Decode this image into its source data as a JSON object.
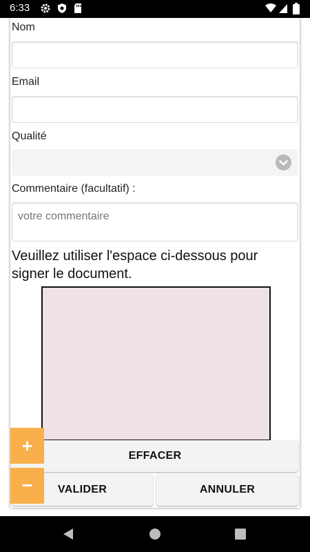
{
  "status_bar": {
    "time": "6:33"
  },
  "form": {
    "nom_label": "Nom",
    "email_label": "Email",
    "qualite_label": "Qualité",
    "commentaire_label": "Commentaire (facultatif) :",
    "commentaire_placeholder": "votre commentaire",
    "instructions": "Veuillez utiliser l'espace ci-dessous pour signer le document."
  },
  "buttons": {
    "effacer": "EFFACER",
    "valider": "VALIDER",
    "annuler": "ANNULER"
  },
  "zoom": {
    "plus": "+",
    "minus": "−"
  },
  "colors": {
    "accent": "#f9b04a",
    "signature_pad": "#efe2e4",
    "select_bg": "#f4f4f4"
  }
}
